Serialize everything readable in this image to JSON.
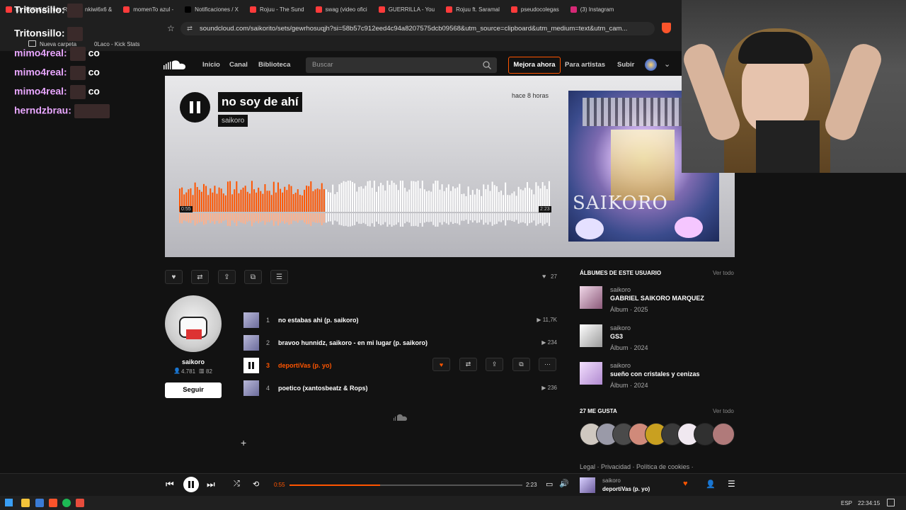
{
  "browser": {
    "tabs": [
      {
        "label": "EL REFLEJO más R",
        "color": "#ff3b3b"
      },
      {
        "label": "nkiwi6x6 & ",
        "color": "#ff3b3b"
      },
      {
        "label": "momenTo azul - ",
        "color": "#ff3b3b"
      },
      {
        "label": "Notificaciones / X",
        "color": "#000000"
      },
      {
        "label": "Rojuu - The Sund",
        "color": "#ff3b3b"
      },
      {
        "label": "swag (video ofici",
        "color": "#ff3b3b"
      },
      {
        "label": "GUERRILLA - You",
        "color": "#ff3b3b"
      },
      {
        "label": "Rojuu ft. Saramal",
        "color": "#ff3b3b"
      },
      {
        "label": "pseudocolegas ",
        "color": "#ff3b3b"
      },
      {
        "label": "(3) Instagram",
        "color": "#d62976"
      }
    ],
    "url": "soundcloud.com/saikorito/sets/gewrhosuqjh?si=58b57c912eed4c94a8207575dcb09568&utm_source=clipboard&utm_medium=text&utm_cam...",
    "bookmarks": [
      "Nueva carpeta",
      "0Laco - Kick Stats"
    ]
  },
  "header": {
    "nav": [
      "Inicio",
      "Canal",
      "Biblioteca"
    ],
    "search_placeholder": "Buscar",
    "upgrade": "Mejora ahora",
    "for_artists": "Para artistas",
    "upload": "Subir"
  },
  "hero": {
    "title": "no soy de ahí",
    "artist": "saikoro",
    "posted": "hace 8 horas",
    "time_current": "0:55",
    "time_total": "2:23",
    "progress": 0.39,
    "cover_text": "SAIKORO",
    "colors": {
      "played": "#ff5500",
      "unplayed": "#ffffff"
    }
  },
  "actions": {
    "icons": [
      "heart-icon",
      "repost-icon",
      "share-icon",
      "copy-icon",
      "add-to-next-icon"
    ],
    "likes": "27"
  },
  "artist_panel": {
    "name": "saikoro",
    "followers": "4.781",
    "tracks": "82",
    "follow_label": "Seguir"
  },
  "tracks": [
    {
      "num": "1",
      "name": "no estabas ahi (p. saikoro)",
      "plays": "11,7K"
    },
    {
      "num": "2",
      "name": "bravoo hunnidz, saikoro - en mi lugar (p. saikoro)",
      "plays": "234"
    },
    {
      "num": "3",
      "name": "deportiVas (p. yo)",
      "plays": ""
    },
    {
      "num": "4",
      "name": "poetico (xantosbeatz & Rops)",
      "plays": "236"
    }
  ],
  "sidebar": {
    "albums_heading": "ÁLBUMES DE ESTE USUARIO",
    "view_all": "Ver todo",
    "albums": [
      {
        "artist": "saikoro",
        "title": "GABRIEL SAIKORO MARQUEZ",
        "meta": "Álbum · 2025"
      },
      {
        "artist": "saikoro",
        "title": "GS3",
        "meta": "Álbum · 2024"
      },
      {
        "artist": "saikoro",
        "title": "sueño con cristales y cenizas",
        "meta": "Álbum · 2024"
      }
    ],
    "likes_heading": "27 ME GUSTA",
    "footer": "Legal · Privacidad · Política de cookies ·"
  },
  "player": {
    "current": "0:55",
    "total": "2:23",
    "progress": 0.39,
    "artist": "saikoro",
    "title": "deportiVas (p. yo)"
  },
  "taskbar": {
    "lang": "ESP",
    "time": "22:34:15"
  },
  "chat": [
    {
      "name": "Tritonsillo:",
      "msg": ""
    },
    {
      "name": "Tritonsillo:",
      "msg": ""
    },
    {
      "name": "mimo4real:",
      "msg": "co"
    },
    {
      "name": "mimo4real:",
      "msg": "co"
    },
    {
      "name": "mimo4real:",
      "msg": "co"
    },
    {
      "name": "herndzbrau:",
      "msg": ""
    }
  ]
}
